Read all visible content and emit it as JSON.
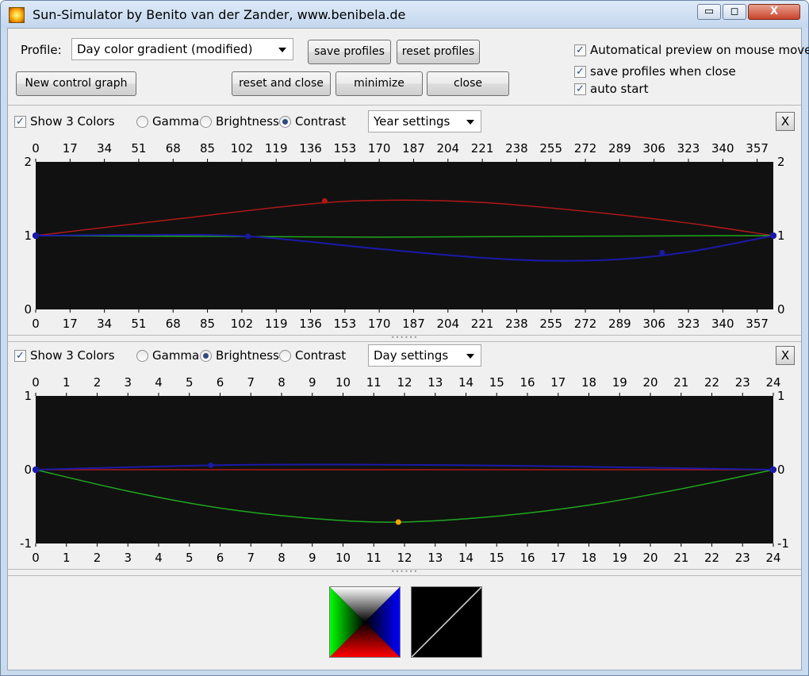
{
  "window": {
    "title": "Sun-Simulator by Benito van der Zander, www.benibela.de",
    "buttons": {
      "minimize_glyph": "▭",
      "maximize_glyph": "◻",
      "close_glyph": "X"
    }
  },
  "toolbar": {
    "profile_label": "Profile:",
    "profile_value": "Day color gradient (modified)",
    "save_profiles": "save profiles",
    "reset_profiles": "reset profiles",
    "new_control_graph": "New control graph",
    "reset_and_close": "reset and close",
    "minimize": "minimize",
    "close": "close"
  },
  "options": {
    "auto_preview": {
      "label": "Automatical preview on mouse move",
      "checked": true
    },
    "save_on_close": {
      "label": "save profiles when close",
      "checked": true
    },
    "auto_start": {
      "label": "auto start",
      "checked": true
    }
  },
  "panels": [
    {
      "show_colors": {
        "label": "Show 3 Colors",
        "checked": true
      },
      "modes": [
        "Gamma",
        "Brightness",
        "Contrast"
      ],
      "selected_mode": "Contrast",
      "settings": "Year settings",
      "close_label": "X"
    },
    {
      "show_colors": {
        "label": "Show 3 Colors",
        "checked": true
      },
      "modes": [
        "Gamma",
        "Brightness",
        "Contrast"
      ],
      "selected_mode": "Brightness",
      "settings": "Day settings",
      "close_label": "X"
    }
  ],
  "colors": {
    "red": "#b01818",
    "green": "#1fa81f",
    "blue": "#1a1aa8",
    "plot_bg": "#111111",
    "highlight": "#ffa500"
  },
  "chart_data": [
    {
      "type": "line",
      "title": "",
      "x_ticks": [
        "0",
        "17",
        "34",
        "51",
        "68",
        "85",
        "102",
        "119",
        "136",
        "153",
        "170",
        "187",
        "204",
        "221",
        "238",
        "255",
        "272",
        "289",
        "306",
        "323",
        "340",
        "357"
      ],
      "y_ticks": [
        "2",
        "1",
        "0"
      ],
      "xlim": [
        0,
        365
      ],
      "ylim": [
        0,
        2
      ],
      "series": [
        {
          "color": "red",
          "x": [
            0,
            68,
            136,
            175,
            221,
            272,
            323,
            365
          ],
          "values": [
            1,
            1.22,
            1.43,
            1.48,
            1.45,
            1.33,
            1.17,
            1
          ]
        },
        {
          "color": "green",
          "x": [
            0,
            85,
            170,
            255,
            340,
            365
          ],
          "values": [
            1,
            0.99,
            0.98,
            0.99,
            1.0,
            1
          ]
        },
        {
          "color": "blue",
          "x": [
            0,
            51,
            105,
            170,
            221,
            255,
            289,
            323,
            365
          ],
          "values": [
            1,
            1.01,
            0.99,
            0.82,
            0.7,
            0.66,
            0.68,
            0.78,
            1
          ]
        }
      ],
      "control_points": [
        {
          "color": "red",
          "x": 143,
          "y": 1.47
        },
        {
          "color": "blue",
          "x": 105,
          "y": 0.99
        },
        {
          "color": "blue",
          "x": 310,
          "y": 0.77
        }
      ]
    },
    {
      "type": "line",
      "title": "",
      "x_ticks": [
        "0",
        "1",
        "2",
        "3",
        "4",
        "5",
        "6",
        "7",
        "8",
        "9",
        "10",
        "11",
        "12",
        "13",
        "14",
        "15",
        "16",
        "17",
        "18",
        "19",
        "20",
        "21",
        "22",
        "23",
        "24"
      ],
      "y_ticks": [
        "1",
        "0",
        "-1"
      ],
      "xlim": [
        0,
        24
      ],
      "ylim": [
        -1,
        1
      ],
      "series": [
        {
          "color": "red",
          "x": [
            0,
            24
          ],
          "values": [
            0,
            0
          ]
        },
        {
          "color": "green",
          "x": [
            0,
            3,
            6,
            9,
            11.8,
            15,
            18,
            21,
            24
          ],
          "values": [
            0,
            -0.29,
            -0.52,
            -0.66,
            -0.71,
            -0.63,
            -0.48,
            -0.26,
            0
          ]
        },
        {
          "color": "blue",
          "x": [
            0,
            5.7,
            10,
            14,
            18,
            24
          ],
          "values": [
            0,
            0.06,
            0.07,
            0.06,
            0.04,
            0
          ]
        }
      ],
      "control_points": [
        {
          "color": "blue",
          "x": 5.7,
          "y": 0.06
        },
        {
          "color": "highlight",
          "x": 11.8,
          "y": -0.71
        }
      ]
    }
  ]
}
